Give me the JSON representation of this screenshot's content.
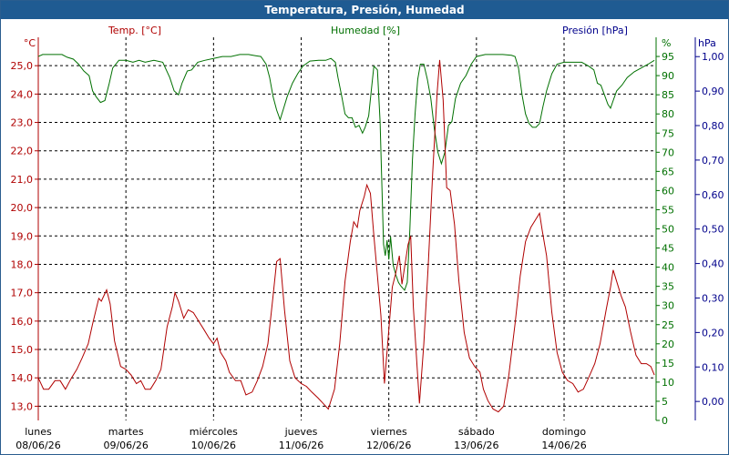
{
  "window": {
    "title": "Temperatura, Presión, Humedad"
  },
  "colors": {
    "temperature": "#b00000",
    "humidity": "#007000",
    "pressure": "#00008b",
    "grid": "#000000",
    "titlebar": "#1f5b92"
  },
  "chart_data": {
    "type": "line",
    "title": "Temperatura, Presión, Humedad",
    "grid": true,
    "legend": "none",
    "x_range": [
      0,
      7.05
    ],
    "x_unit": "days since lunes 08/06/26 00:00",
    "categories": [
      {
        "day": "lunes",
        "date": "08/06/26"
      },
      {
        "day": "martes",
        "date": "09/06/26"
      },
      {
        "day": "miércoles",
        "date": "10/06/26"
      },
      {
        "day": "jueves",
        "date": "11/06/26"
      },
      {
        "day": "viernes",
        "date": "12/06/26"
      },
      {
        "day": "sábado",
        "date": "13/06/26"
      },
      {
        "day": "domingo",
        "date": "14/06/26"
      }
    ],
    "axes": {
      "temperature": {
        "label": "Temp. [°C]",
        "unit": "°C",
        "side": "left",
        "range": [
          12.5,
          26.0
        ],
        "ticks": [
          "13,0",
          "14,0",
          "15,0",
          "16,0",
          "17,0",
          "18,0",
          "19,0",
          "20,0",
          "21,0",
          "22,0",
          "23,0",
          "24,0",
          "25,0"
        ]
      },
      "humidity": {
        "label": "Humedad [%]",
        "unit": "%",
        "side": "right",
        "range": [
          0,
          100
        ],
        "ticks": [
          "0",
          "5",
          "10",
          "15",
          "20",
          "25",
          "30",
          "35",
          "40",
          "45",
          "50",
          "55",
          "60",
          "65",
          "70",
          "75",
          "80",
          "85",
          "90",
          "95"
        ]
      },
      "pressure": {
        "label": "Presión [hPa]",
        "unit": "hPa",
        "side": "right",
        "range": [
          -0.055,
          1.056
        ],
        "ticks": [
          "0,00",
          "0,10",
          "0,20",
          "0,30",
          "0,40",
          "0,50",
          "0,60",
          "0,70",
          "0,80",
          "0,90",
          "1,00"
        ]
      }
    },
    "series": [
      {
        "name": "Temp. [°C]",
        "axis": "temperature",
        "points": [
          [
            0.0,
            14.0
          ],
          [
            0.06,
            13.6
          ],
          [
            0.12,
            13.6
          ],
          [
            0.19,
            13.9
          ],
          [
            0.25,
            13.9
          ],
          [
            0.31,
            13.6
          ],
          [
            0.38,
            14.0
          ],
          [
            0.44,
            14.3
          ],
          [
            0.5,
            14.7
          ],
          [
            0.57,
            15.2
          ],
          [
            0.62,
            15.9
          ],
          [
            0.69,
            16.8
          ],
          [
            0.72,
            16.7
          ],
          [
            0.78,
            17.1
          ],
          [
            0.82,
            16.6
          ],
          [
            0.87,
            15.3
          ],
          [
            0.94,
            14.4
          ],
          [
            1.0,
            14.3
          ],
          [
            1.06,
            14.1
          ],
          [
            1.12,
            13.8
          ],
          [
            1.17,
            13.9
          ],
          [
            1.22,
            13.6
          ],
          [
            1.28,
            13.6
          ],
          [
            1.34,
            13.9
          ],
          [
            1.4,
            14.3
          ],
          [
            1.47,
            15.8
          ],
          [
            1.53,
            16.5
          ],
          [
            1.56,
            17.0
          ],
          [
            1.6,
            16.7
          ],
          [
            1.66,
            16.1
          ],
          [
            1.71,
            16.4
          ],
          [
            1.77,
            16.3
          ],
          [
            1.83,
            16.0
          ],
          [
            1.89,
            15.7
          ],
          [
            1.95,
            15.4
          ],
          [
            2.0,
            15.2
          ],
          [
            2.04,
            15.4
          ],
          [
            2.08,
            14.9
          ],
          [
            2.14,
            14.6
          ],
          [
            2.18,
            14.2
          ],
          [
            2.25,
            13.9
          ],
          [
            2.31,
            13.9
          ],
          [
            2.37,
            13.4
          ],
          [
            2.44,
            13.5
          ],
          [
            2.5,
            13.9
          ],
          [
            2.56,
            14.4
          ],
          [
            2.62,
            15.2
          ],
          [
            2.68,
            16.9
          ],
          [
            2.72,
            18.1
          ],
          [
            2.76,
            18.2
          ],
          [
            2.81,
            16.4
          ],
          [
            2.87,
            14.6
          ],
          [
            2.93,
            14.0
          ],
          [
            3.0,
            13.8
          ],
          [
            3.06,
            13.7
          ],
          [
            3.12,
            13.5
          ],
          [
            3.19,
            13.3
          ],
          [
            3.25,
            13.1
          ],
          [
            3.31,
            12.9
          ],
          [
            3.38,
            13.6
          ],
          [
            3.44,
            15.2
          ],
          [
            3.5,
            17.4
          ],
          [
            3.56,
            18.8
          ],
          [
            3.6,
            19.5
          ],
          [
            3.64,
            19.3
          ],
          [
            3.67,
            19.9
          ],
          [
            3.72,
            20.4
          ],
          [
            3.75,
            20.8
          ],
          [
            3.79,
            20.5
          ],
          [
            3.83,
            19.0
          ],
          [
            3.87,
            17.6
          ],
          [
            3.91,
            16.2
          ],
          [
            3.95,
            13.8
          ],
          [
            4.0,
            15.7
          ],
          [
            4.04,
            17.2
          ],
          [
            4.08,
            17.7
          ],
          [
            4.12,
            18.3
          ],
          [
            4.15,
            17.3
          ],
          [
            4.18,
            17.9
          ],
          [
            4.22,
            18.7
          ],
          [
            4.25,
            19.0
          ],
          [
            4.28,
            16.5
          ],
          [
            4.32,
            14.5
          ],
          [
            4.35,
            13.1
          ],
          [
            4.4,
            15.2
          ],
          [
            4.45,
            18.0
          ],
          [
            4.5,
            21.2
          ],
          [
            4.55,
            24.0
          ],
          [
            4.58,
            25.2
          ],
          [
            4.62,
            23.8
          ],
          [
            4.66,
            20.7
          ],
          [
            4.7,
            20.6
          ],
          [
            4.75,
            19.4
          ],
          [
            4.8,
            17.4
          ],
          [
            4.86,
            15.6
          ],
          [
            4.92,
            14.7
          ],
          [
            4.98,
            14.4
          ],
          [
            5.04,
            14.2
          ],
          [
            5.08,
            13.6
          ],
          [
            5.13,
            13.2
          ],
          [
            5.19,
            12.9
          ],
          [
            5.25,
            12.8
          ],
          [
            5.31,
            13.0
          ],
          [
            5.37,
            14.1
          ],
          [
            5.44,
            15.9
          ],
          [
            5.5,
            17.6
          ],
          [
            5.56,
            18.8
          ],
          [
            5.62,
            19.3
          ],
          [
            5.68,
            19.6
          ],
          [
            5.72,
            19.8
          ],
          [
            5.75,
            19.2
          ],
          [
            5.8,
            18.3
          ],
          [
            5.86,
            16.3
          ],
          [
            5.92,
            14.9
          ],
          [
            5.98,
            14.2
          ],
          [
            6.04,
            13.9
          ],
          [
            6.1,
            13.8
          ],
          [
            6.16,
            13.5
          ],
          [
            6.22,
            13.6
          ],
          [
            6.28,
            14.0
          ],
          [
            6.35,
            14.5
          ],
          [
            6.41,
            15.2
          ],
          [
            6.48,
            16.4
          ],
          [
            6.53,
            17.2
          ],
          [
            6.56,
            17.8
          ],
          [
            6.6,
            17.4
          ],
          [
            6.65,
            16.9
          ],
          [
            6.7,
            16.5
          ],
          [
            6.76,
            15.6
          ],
          [
            6.82,
            14.8
          ],
          [
            6.88,
            14.5
          ],
          [
            6.94,
            14.5
          ],
          [
            6.99,
            14.4
          ],
          [
            7.03,
            14.1
          ]
        ]
      },
      {
        "name": "Humedad [%]",
        "axis": "humidity",
        "points": [
          [
            0.0,
            95
          ],
          [
            0.05,
            95.5
          ],
          [
            0.12,
            95.5
          ],
          [
            0.2,
            95.5
          ],
          [
            0.27,
            95.5
          ],
          [
            0.33,
            94.8
          ],
          [
            0.4,
            94.3
          ],
          [
            0.46,
            93
          ],
          [
            0.52,
            91.2
          ],
          [
            0.58,
            90
          ],
          [
            0.62,
            86
          ],
          [
            0.66,
            84.5
          ],
          [
            0.71,
            83
          ],
          [
            0.76,
            83.5
          ],
          [
            0.81,
            88
          ],
          [
            0.85,
            92
          ],
          [
            0.92,
            94
          ],
          [
            1.0,
            94
          ],
          [
            1.08,
            93.5
          ],
          [
            1.15,
            94
          ],
          [
            1.22,
            93.5
          ],
          [
            1.32,
            94
          ],
          [
            1.42,
            93.5
          ],
          [
            1.5,
            89.5
          ],
          [
            1.55,
            86
          ],
          [
            1.6,
            85
          ],
          [
            1.64,
            88
          ],
          [
            1.7,
            91.2
          ],
          [
            1.75,
            91.5
          ],
          [
            1.82,
            93.5
          ],
          [
            1.9,
            94
          ],
          [
            2.0,
            94.5
          ],
          [
            2.1,
            95
          ],
          [
            2.2,
            95
          ],
          [
            2.3,
            95.5
          ],
          [
            2.4,
            95.5
          ],
          [
            2.48,
            95.2
          ],
          [
            2.54,
            95
          ],
          [
            2.6,
            93
          ],
          [
            2.64,
            89.5
          ],
          [
            2.68,
            84.5
          ],
          [
            2.72,
            81
          ],
          [
            2.76,
            78.5
          ],
          [
            2.8,
            81.5
          ],
          [
            2.84,
            84.5
          ],
          [
            2.9,
            88
          ],
          [
            2.96,
            90.5
          ],
          [
            3.02,
            92.5
          ],
          [
            3.1,
            93.8
          ],
          [
            3.2,
            94
          ],
          [
            3.28,
            94
          ],
          [
            3.34,
            94.5
          ],
          [
            3.39,
            93.5
          ],
          [
            3.42,
            89.5
          ],
          [
            3.46,
            85
          ],
          [
            3.5,
            80
          ],
          [
            3.54,
            79
          ],
          [
            3.58,
            79
          ],
          [
            3.62,
            76.5
          ],
          [
            3.66,
            77
          ],
          [
            3.7,
            75
          ],
          [
            3.73,
            76.5
          ],
          [
            3.77,
            79.5
          ],
          [
            3.8,
            86
          ],
          [
            3.83,
            92.5
          ],
          [
            3.87,
            91.5
          ],
          [
            3.9,
            78
          ],
          [
            3.92,
            62
          ],
          [
            3.94,
            46
          ],
          [
            3.96,
            43
          ],
          [
            3.98,
            47
          ],
          [
            4.0,
            42
          ],
          [
            4.02,
            48
          ],
          [
            4.05,
            40.5
          ],
          [
            4.08,
            38
          ],
          [
            4.11,
            36
          ],
          [
            4.14,
            35
          ],
          [
            4.18,
            34
          ],
          [
            4.21,
            36
          ],
          [
            4.24,
            50
          ],
          [
            4.27,
            68
          ],
          [
            4.3,
            80
          ],
          [
            4.33,
            89
          ],
          [
            4.36,
            93
          ],
          [
            4.4,
            93
          ],
          [
            4.44,
            89
          ],
          [
            4.48,
            84
          ],
          [
            4.52,
            76
          ],
          [
            4.56,
            70
          ],
          [
            4.6,
            67
          ],
          [
            4.64,
            70
          ],
          [
            4.68,
            77
          ],
          [
            4.72,
            78
          ],
          [
            4.76,
            84
          ],
          [
            4.82,
            88
          ],
          [
            4.88,
            90
          ],
          [
            4.94,
            93
          ],
          [
            5.0,
            95
          ],
          [
            5.1,
            95.5
          ],
          [
            5.2,
            95.5
          ],
          [
            5.3,
            95.5
          ],
          [
            5.4,
            95.3
          ],
          [
            5.44,
            95
          ],
          [
            5.48,
            92
          ],
          [
            5.52,
            85
          ],
          [
            5.56,
            80
          ],
          [
            5.6,
            77.5
          ],
          [
            5.64,
            76.5
          ],
          [
            5.68,
            76.5
          ],
          [
            5.72,
            77.5
          ],
          [
            5.76,
            82
          ],
          [
            5.8,
            86
          ],
          [
            5.86,
            90.5
          ],
          [
            5.92,
            93
          ],
          [
            6.0,
            93.5
          ],
          [
            6.1,
            93.5
          ],
          [
            6.2,
            93.5
          ],
          [
            6.28,
            92.5
          ],
          [
            6.34,
            91.5
          ],
          [
            6.38,
            88
          ],
          [
            6.42,
            87.5
          ],
          [
            6.46,
            85
          ],
          [
            6.5,
            82.5
          ],
          [
            6.53,
            81.5
          ],
          [
            6.56,
            83.5
          ],
          [
            6.6,
            86
          ],
          [
            6.66,
            87.5
          ],
          [
            6.72,
            89.5
          ],
          [
            6.8,
            91
          ],
          [
            6.88,
            92
          ],
          [
            6.96,
            93
          ],
          [
            7.03,
            94
          ]
        ]
      },
      {
        "name": "Presión [hPa]",
        "axis": "pressure",
        "points": []
      }
    ]
  }
}
